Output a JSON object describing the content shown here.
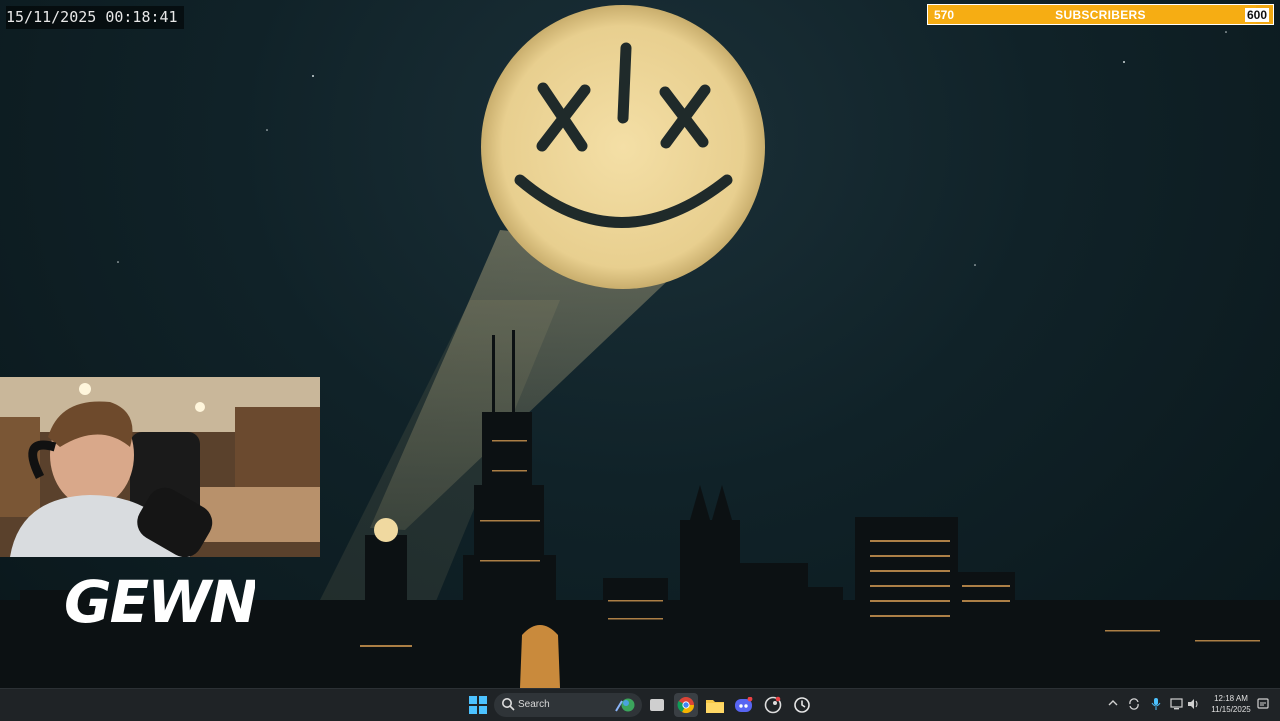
{
  "overlay": {
    "datetime": "15/11/2025 00:18:41"
  },
  "subscriber_goal": {
    "current": "570",
    "label": "SUBSCRIBERS",
    "goal": "600",
    "progress_fraction": 0.95
  },
  "streamer_logo": {
    "text": "GEWN"
  },
  "taskbar": {
    "search_label": "Search",
    "icons": [
      "windows-start-icon",
      "search-icon",
      "task-view-icon",
      "chrome-icon",
      "file-explorer-icon",
      "discord-icon",
      "steam-icon",
      "clock-app-icon"
    ],
    "tray_icons": [
      "chevron-up-icon",
      "sync-icon",
      "microphone-icon",
      "network-icon",
      "volume-icon",
      "notification-icon"
    ],
    "clock_time": "12:18 AM",
    "clock_date": "11/15/2025"
  },
  "colors": {
    "goal_bar": "#f2a812",
    "taskbar_bg": "#1f2326",
    "sky": "#102228",
    "signal_light": "#f0d79a"
  }
}
